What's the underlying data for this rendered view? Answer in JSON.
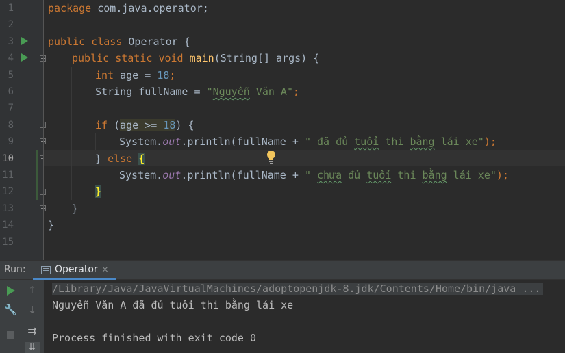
{
  "editor": {
    "line_numbers": [
      "1",
      "2",
      "3",
      "4",
      "5",
      "6",
      "7",
      "8",
      "9",
      "10",
      "11",
      "12",
      "13",
      "14",
      "15"
    ],
    "current_line": "10",
    "code": {
      "l1": {
        "kw": "package",
        "rest": " com.java.operator;"
      },
      "l3": {
        "kw1": "public",
        "kw2": "class",
        "rest": " Operator {"
      },
      "l4": {
        "kw1": "public",
        "kw2": "static",
        "kw3": "void",
        "fn": "main",
        "rest": "(String[] args) {"
      },
      "l5": {
        "kw": "int",
        "rest": " age = ",
        "num": "18",
        "end": ";"
      },
      "l6": {
        "pre": "String fullName = ",
        "q": "\"",
        "typo": "Nguyễn",
        "str": " Văn A\"",
        "end": ";"
      },
      "l8": {
        "kw": "if",
        "open": " (",
        "cond": "age >= ",
        "num": "18",
        "close": ") {"
      },
      "l9": {
        "pre": "System.",
        "field": "out",
        "mid": ".println(fullName + ",
        "s1": "\" đã đủ ",
        "typo": "tuổi",
        "s2": " thi ",
        "typo2": "bằng",
        "s3": " lái xe\"",
        "end": ");"
      },
      "l10": {
        "pre": "} ",
        "kw": "else",
        "sp": " ",
        "brace": "{"
      },
      "l11": {
        "pre": "System.",
        "field": "out",
        "mid": ".println(fullName + ",
        "s1": "\" ",
        "typo1": "chưa",
        "s2": " đủ ",
        "typo2": "tuổi",
        "s3": " thi ",
        "typo3": "bằng",
        "s4": " lái xe\"",
        "end": ");"
      },
      "l12": {
        "brace": "}"
      },
      "l13": {
        "text": "}"
      },
      "l14": {
        "text": "}"
      }
    }
  },
  "run_panel": {
    "label": "Run:",
    "tab_label": "Operator",
    "tab_close": "×",
    "console": {
      "command": "/Library/Java/JavaVirtualMachines/adoptopenjdk-8.jdk/Contents/Home/bin/java ...",
      "output": "Nguyễn Văn A đã đủ tuổi thi bằng lái xe",
      "exit": "Process finished with exit code 0"
    },
    "toolbar_glyphs": {
      "up": "↑",
      "down": "↓",
      "wrench": "🔧",
      "wrap": "⇉",
      "scroll_end": "⇊"
    }
  },
  "colors": {
    "background": "#2b2b2b",
    "keyword": "#cc7832",
    "string": "#6a8759",
    "number": "#6897bb",
    "function": "#ffc66d",
    "field": "#9876aa",
    "run_accent": "#499c54",
    "tab_underline": "#4a88c7"
  }
}
